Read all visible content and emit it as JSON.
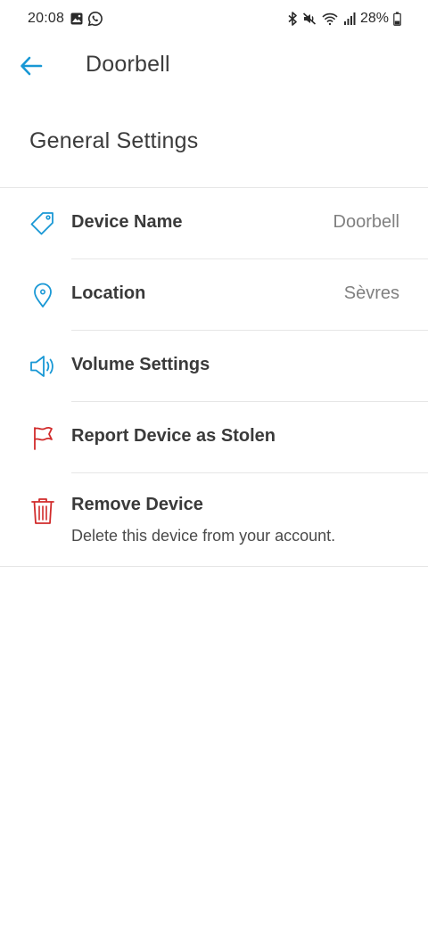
{
  "status_bar": {
    "time": "20:08",
    "battery": "28%",
    "icons_left": [
      "gallery-icon",
      "whatsapp-icon"
    ],
    "icons_right": [
      "bluetooth-icon",
      "mute-icon",
      "wifi-icon",
      "signal-icon",
      "battery-icon"
    ]
  },
  "header": {
    "back_icon": "arrow-left-icon",
    "title": "Doorbell"
  },
  "section": {
    "title": "General Settings"
  },
  "settings": {
    "items": [
      {
        "label": "Device Name",
        "value": "Doorbell",
        "icon": "tag-icon"
      },
      {
        "label": "Location",
        "value": "Sèvres",
        "icon": "location-pin-icon"
      },
      {
        "label": "Volume Settings",
        "icon": "speaker-icon"
      },
      {
        "label": "Report Device as Stolen",
        "icon": "flag-icon"
      },
      {
        "label": "Remove Device",
        "sublabel": "Delete this device from your account.",
        "icon": "trash-icon"
      }
    ]
  },
  "colors": {
    "accent": "#1998d5",
    "danger": "#d12b2b",
    "text": "#3a3a3a",
    "secondary_text": "#808080",
    "divider": "#e6e6e6"
  }
}
